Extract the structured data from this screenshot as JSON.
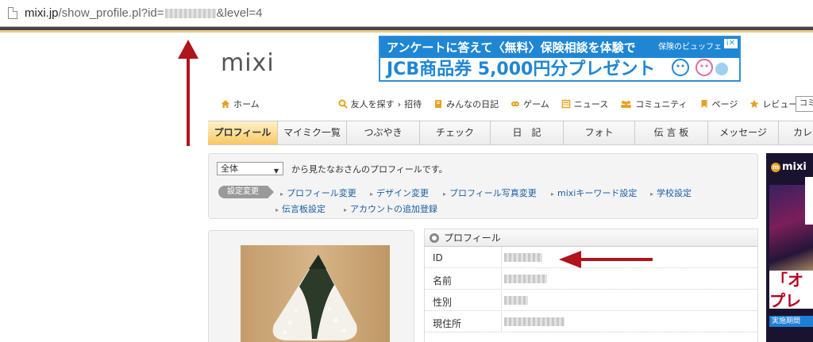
{
  "address_bar": {
    "host": "mixi.jp",
    "path": "/show_profile.pl?id=",
    "query_suffix": "&level=4"
  },
  "logo": "mixi",
  "banner": {
    "line1": "アンケートに答えて〈無料〉保険相談を体験で",
    "brand": "保険のビュッフェ",
    "line2": "JCB商品券 5,000円分プレゼント"
  },
  "nav": {
    "home": "ホーム",
    "find_friends": "友人を探す",
    "invite": "招待",
    "diary": "みんなの日記",
    "game": "ゲーム",
    "news": "ニュース",
    "community": "コミュニティ",
    "page": "ページ",
    "review": "レビュー",
    "search_partial": "コミ"
  },
  "tabs": [
    {
      "label": "プロフィール"
    },
    {
      "label": "マイミク一覧"
    },
    {
      "label": "つぶやき"
    },
    {
      "label": "チェック"
    },
    {
      "label": "日　記"
    },
    {
      "label": "フォト"
    },
    {
      "label": "伝 言 板"
    },
    {
      "label": "メッセージ"
    },
    {
      "label": "カレ"
    }
  ],
  "view": {
    "select_value": "全体",
    "description": "から見たなおさんのプロフィールです。"
  },
  "settings": {
    "label": "設定変更",
    "links": [
      "プロフィール変更",
      "デザイン変更",
      "プロフィール写真変更",
      "mixiキーワード設定",
      "学校設定",
      "伝言板設定",
      "アカウントの追加登録"
    ]
  },
  "profile": {
    "heading": "プロフィール",
    "rows": [
      {
        "key": "ID"
      },
      {
        "key": "名前"
      },
      {
        "key": "性別"
      },
      {
        "key": "現住所"
      }
    ]
  },
  "side_ad": {
    "logo": "mixi",
    "text1": "「オ",
    "text2": "プレ",
    "text3": "実施期間"
  },
  "colors": {
    "active_tab": "#f8c862",
    "link": "#1a5ea8",
    "annotation_arrow": "#b0141c"
  }
}
